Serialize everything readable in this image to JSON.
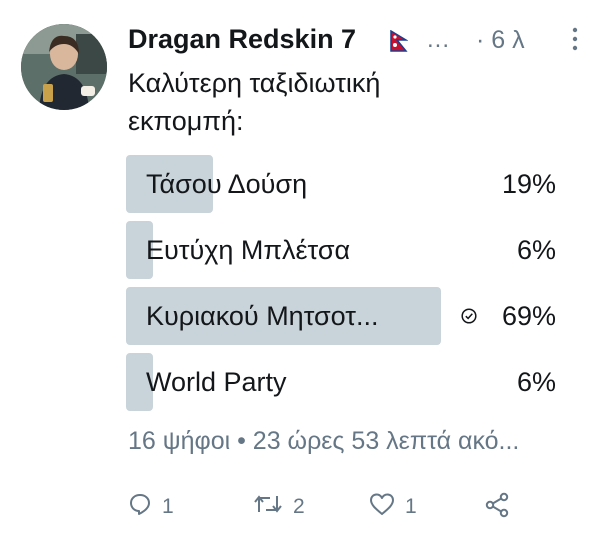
{
  "tweet": {
    "author": "Dragan Redskin 7",
    "ellipsis": "...",
    "time": "· 6 λ",
    "question_line1": "Καλύτερη ταξιδιωτική",
    "question_line2": "εκπομπή:"
  },
  "poll": {
    "options": [
      {
        "label": "Τάσου Δούση",
        "percent_text": "19%",
        "percent": 19,
        "winner": false
      },
      {
        "label": "Ευτύχη Μπλέτσα",
        "percent_text": "6%",
        "percent": 6,
        "winner": false
      },
      {
        "label": "Κυριακού Μητσοτ...",
        "percent_text": "69%",
        "percent": 69,
        "winner": true
      },
      {
        "label": "World Party",
        "percent_text": "6%",
        "percent": 6,
        "winner": false
      }
    ],
    "meta": "16 ψήφοι • 23 ώρες 53 λεπτά ακό..."
  },
  "actions": {
    "reply_count": "1",
    "retweet_count": "2",
    "like_count": "1"
  },
  "colors": {
    "bar": "#c9d3da",
    "muted": "#657786",
    "text": "#14171a"
  },
  "icons": [
    "more-vert-icon",
    "nepal-flag-icon",
    "check-circle-icon",
    "reply-icon",
    "retweet-icon",
    "like-icon",
    "share-icon"
  ]
}
